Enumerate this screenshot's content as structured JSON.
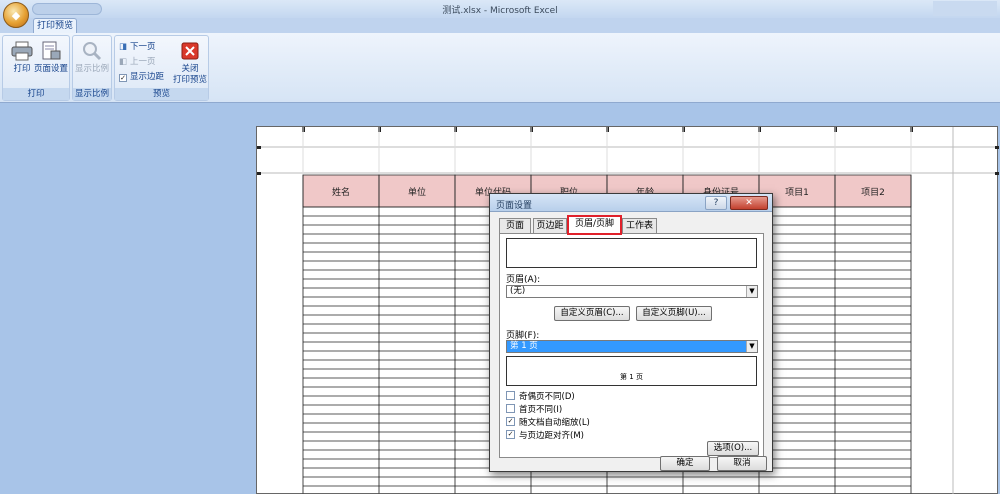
{
  "window": {
    "title": "测试.xlsx - Microsoft Excel"
  },
  "office_button": {
    "glyph": "◆"
  },
  "ribbon": {
    "active_tab": "打印预览",
    "groups": {
      "print": {
        "label": "打印",
        "buttons": {
          "print": "打印",
          "page_setup": "页面设置"
        }
      },
      "zoom": {
        "label": "显示比例",
        "buttons": {
          "zoom": "显示比例"
        }
      },
      "preview": {
        "label": "预览",
        "next_page": "下一页",
        "prev_page": "上一页",
        "show_margins": "显示边距",
        "show_margins_checked": true,
        "close_line1": "关闭",
        "close_line2": "打印预览"
      }
    }
  },
  "sheet": {
    "headers": [
      "姓名",
      "单位",
      "单位代码",
      "职位",
      "年龄",
      "身份证号",
      "项目1",
      "项目2"
    ],
    "header_fill": "#f0c8c8"
  },
  "dialog": {
    "title": "页面设置",
    "help": "?",
    "close": "✕",
    "tabs": [
      "页面",
      "页边距",
      "页眉/页脚",
      "工作表"
    ],
    "active_tab": 2,
    "header_label": "页眉(A):",
    "header_value": "(无)",
    "custom_header": "自定义页眉(C)...",
    "custom_footer": "自定义页脚(U)...",
    "footer_label": "页脚(F):",
    "footer_value": "第 1 页",
    "footer_preview": "第 1 页",
    "checkboxes": [
      {
        "label": "奇偶页不同(D)",
        "checked": false
      },
      {
        "label": "首页不同(I)",
        "checked": false
      },
      {
        "label": "随文档自动缩放(L)",
        "checked": true
      },
      {
        "label": "与页边距对齐(M)",
        "checked": true
      }
    ],
    "options_button": "选项(O)...",
    "ok": "确定",
    "cancel": "取消"
  },
  "colors": {
    "accent": "#15428b",
    "highlight": "#e0202a",
    "selection": "#3399ff"
  }
}
